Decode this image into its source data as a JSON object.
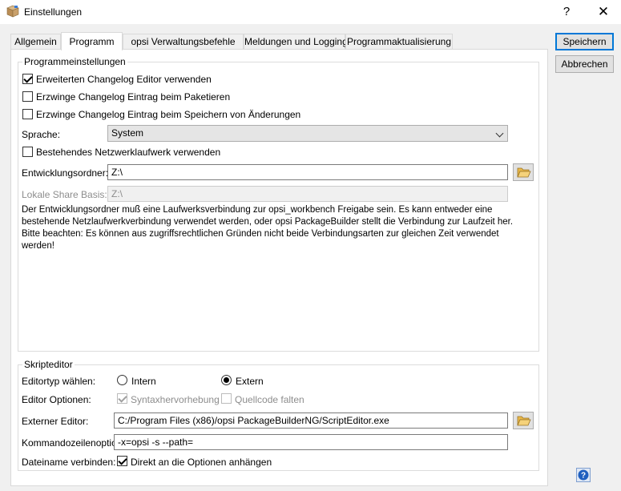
{
  "window": {
    "title": "Einstellungen",
    "help_glyph": "?",
    "close_glyph": "✕",
    "app_icon": "package-box-icon"
  },
  "tabs": [
    {
      "label": "Allgemein",
      "active": false
    },
    {
      "label": "Programm",
      "active": true
    },
    {
      "label": "opsi Verwaltungsbefehle",
      "active": false
    },
    {
      "label": "Meldungen und Logging",
      "active": false
    },
    {
      "label": "Programmaktualisierung",
      "active": false
    }
  ],
  "program": {
    "legend": "Programmeinstellungen",
    "chk_changelog_editor": {
      "label": "Erweiterten Changelog Editor verwenden",
      "checked": true
    },
    "chk_force_pack": {
      "label": "Erzwinge Changelog Eintrag beim Paketieren",
      "checked": false
    },
    "chk_force_save": {
      "label": "Erzwinge Changelog Eintrag beim Speichern von Änderungen",
      "checked": false
    },
    "language": {
      "label": "Sprache:",
      "value": "System"
    },
    "chk_network_drive": {
      "label": "Bestehendes Netzwerklaufwerk verwenden",
      "checked": false
    },
    "dev_folder": {
      "label": "Entwicklungsordner:",
      "value": "Z:\\"
    },
    "share_base": {
      "label": "Lokale Share Basis:",
      "value": "Z:\\"
    },
    "description": "Der Entwicklungsordner muß eine Laufwerksverbindung zur opsi_workbench Freigabe sein. Es kann entweder eine bestehende Netzlaufwerkverbindung verwendet werden, oder opsi PackageBuilder stellt die Verbindung zur Laufzeit her. Bitte beachten: Es können aus zugriffsrechtlichen Gründen nicht beide Verbindungsarten zur gleichen Zeit verwendet werden!"
  },
  "script": {
    "legend": "Skripteditor",
    "editor_type": {
      "label": "Editortyp wählen:",
      "opt_intern": "Intern",
      "opt_extern": "Extern",
      "selected": "Extern"
    },
    "options": {
      "label": "Editor Optionen:",
      "syntax": "Syntaxhervorhebung",
      "syntax_checked": true,
      "fold": "Quellcode falten",
      "fold_checked": false
    },
    "external_editor": {
      "label": "Externer Editor:",
      "value": "C:/Program Files (x86)/opsi PackageBuilderNG/ScriptEditor.exe"
    },
    "cmdline": {
      "label": "Kommandozeilenoption:",
      "value": "-x=opsi -s --path="
    },
    "filename": {
      "label": "Dateiname verbinden:",
      "chk_label": "Direkt an die Optionen anhängen",
      "checked": true
    }
  },
  "buttons": {
    "save": "Speichern",
    "cancel": "Abbrechen"
  },
  "colors": {
    "accent": "#0078d7",
    "help": "#1f5fbf"
  }
}
